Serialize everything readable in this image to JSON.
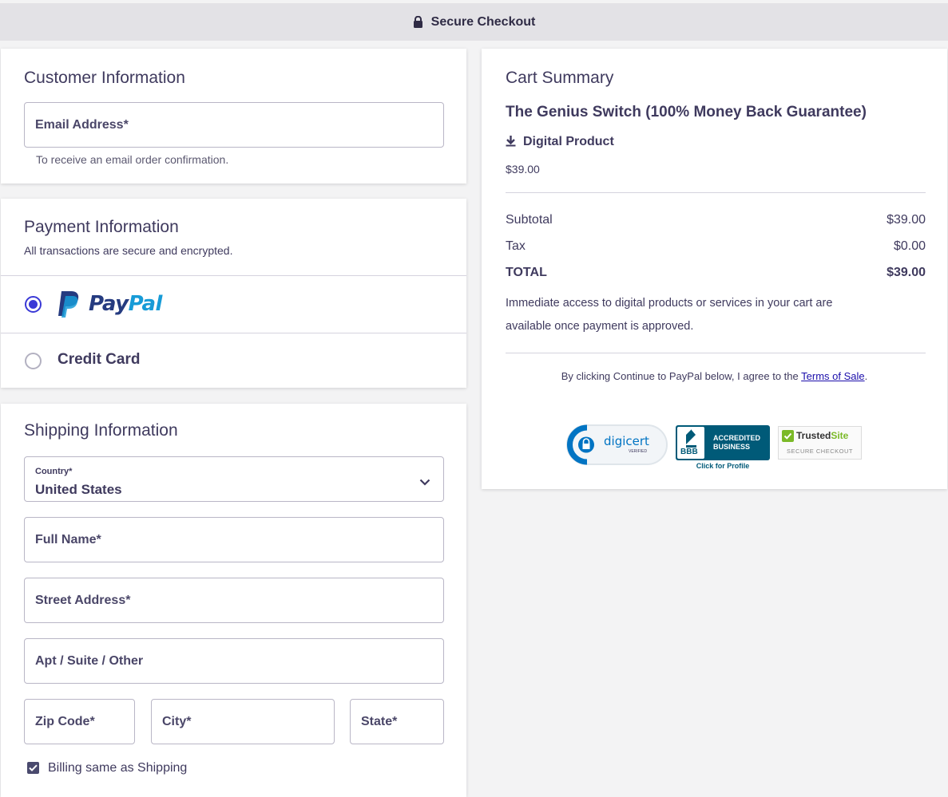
{
  "header": {
    "title": "Secure Checkout",
    "icon": "lock-icon"
  },
  "customer": {
    "title": "Customer Information",
    "email_placeholder": "Email Address*",
    "email_hint": "To receive an email order confirmation."
  },
  "payment": {
    "title": "Payment Information",
    "subtitle": "All transactions are secure and encrypted.",
    "options": [
      {
        "label_pay": "Pay",
        "label_pal": "Pal",
        "selected": true
      },
      {
        "label": "Credit Card",
        "selected": false
      }
    ]
  },
  "shipping": {
    "title": "Shipping Information",
    "country_label": "Country*",
    "country_value": "United States",
    "full_name": "Full Name*",
    "street": "Street Address*",
    "apt": "Apt / Suite / Other",
    "zip": "Zip Code*",
    "city": "City*",
    "state": "State*",
    "billing_same": "Billing same as Shipping",
    "billing_checked": true
  },
  "cart": {
    "title": "Cart Summary",
    "product_name": "The Genius Switch (100% Money Back Guarantee)",
    "product_type": "Digital Product",
    "product_price": "$39.00",
    "subtotal_label": "Subtotal",
    "subtotal_value": "$39.00",
    "tax_label": "Tax",
    "tax_value": "$0.00",
    "total_label": "TOTAL",
    "total_value": "$39.00",
    "access_note_1": "Immediate access to digital products or services in your cart are",
    "access_note_2": "available once payment is approved.",
    "agree_text": "By clicking Continue to PayPal below, I agree to the ",
    "terms_link": "Terms of Sale",
    "agree_end": "."
  },
  "badges": {
    "digicert": "digicert",
    "digicert_sub": "VERIFIED",
    "bbb_line1": "ACCREDITED",
    "bbb_line2": "BUSINESS",
    "bbb_mark": "BBB",
    "bbb_click": "Click for Profile",
    "trusted_a": "Trusted",
    "trusted_b": "Site",
    "trusted_sub": "SECURE CHECKOUT"
  },
  "colors": {
    "accent": "#3a39d6",
    "text": "#3f3a5e",
    "paypal_dark": "#253b80",
    "paypal_light": "#179bd7",
    "bbb_teal": "#005a78",
    "digicert_blue": "#0174c3",
    "trusted_green": "#7bb928"
  }
}
